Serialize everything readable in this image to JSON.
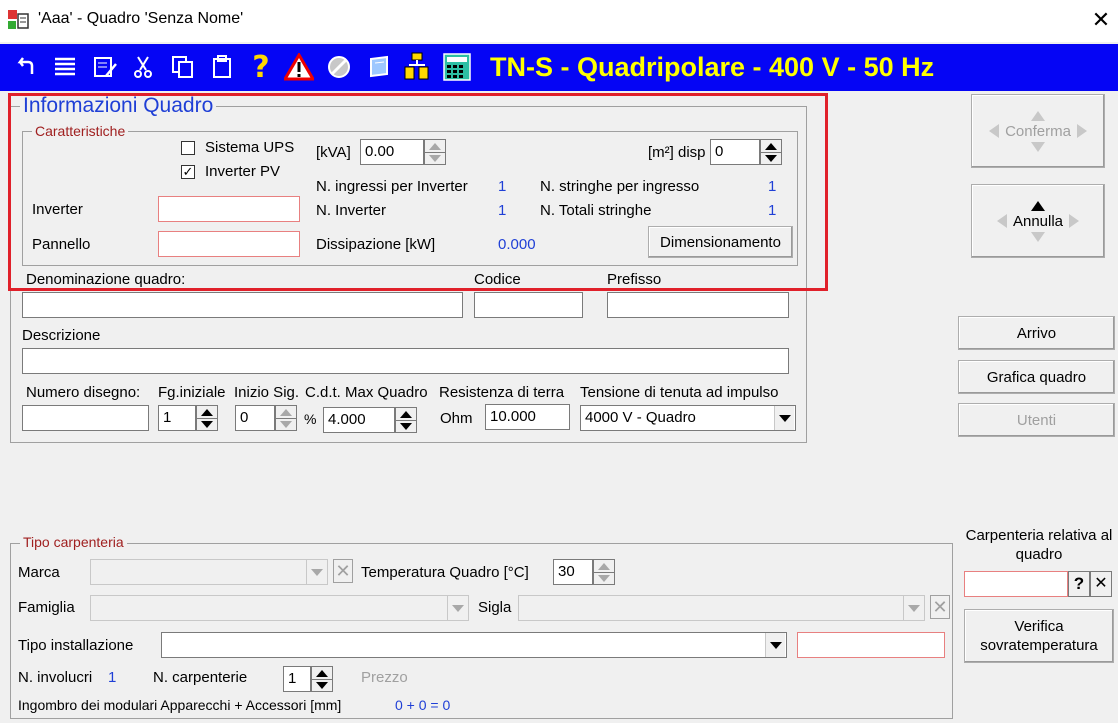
{
  "window": {
    "title": "'Aaa' - Quadro 'Senza Nome'",
    "close_glyph": "✕"
  },
  "toolbar": {
    "title": "TN-S - Quadripolare - 400 V - 50 Hz"
  },
  "info": {
    "legend": "Informazioni Quadro",
    "caratteristiche": {
      "legend": "Caratteristiche",
      "sistema_ups_label": "Sistema UPS",
      "sistema_ups_checked": false,
      "inverter_pv_label": "Inverter PV",
      "inverter_pv_checked": true,
      "check_glyph": "✓",
      "kva_label": "[kVA]",
      "kva_value": "0.00",
      "mq_label": "[m²] disp",
      "mq_value": "0",
      "n_ingressi_label": "N. ingressi per Inverter",
      "n_ingressi_value": "1",
      "n_stringhe_label": "N. stringhe per ingresso",
      "n_stringhe_value": "1",
      "inverter_label": "Inverter",
      "n_inverter_label": "N. Inverter",
      "n_inverter_value": "1",
      "n_totali_label": "N. Totali stringhe",
      "n_totali_value": "1",
      "pannello_label": "Pannello",
      "dissipazione_label": "Dissipazione [kW]",
      "dissipazione_value": "0.000",
      "dimensionamento_label": "Dimensionamento"
    },
    "denominazione_label": "Denominazione quadro:",
    "codice_label": "Codice",
    "prefisso_label": "Prefisso",
    "descrizione_label": "Descrizione",
    "numero_disegno_label": "Numero disegno:",
    "fg_iniziale_label": "Fg.iniziale",
    "fg_iniziale_value": "1",
    "inizio_sig_label": "Inizio Sig.",
    "inizio_sig_value": "0",
    "cdt_label": "C.d.t. Max Quadro",
    "cdt_unit": "%",
    "cdt_value": "4.000",
    "resistenza_label": "Resistenza di terra",
    "resistenza_unit": "Ohm",
    "resistenza_value": "10.000",
    "tensione_label": "Tensione di tenuta ad impulso",
    "tensione_value": "4000 V - Quadro"
  },
  "side": {
    "conferma": "Conferma",
    "annulla": "Annulla",
    "arrivo": "Arrivo",
    "grafica": "Grafica quadro",
    "utenti": "Utenti",
    "carpenteria_relativa": "Carpenteria relativa al quadro",
    "help_glyph": "?",
    "clear_glyph": "✕",
    "verifica": "Verifica sovratemperatura"
  },
  "carpenteria": {
    "legend": "Tipo carpenteria",
    "marca_label": "Marca",
    "temp_label": "Temperatura Quadro [°C]",
    "temp_value": "30",
    "famiglia_label": "Famiglia",
    "sigla_label": "Sigla",
    "tipo_inst_label": "Tipo installazione",
    "n_involucri_label": "N. involucri",
    "n_involucri_value": "1",
    "n_carpenterie_label": "N. carpenterie",
    "n_carpenterie_value": "1",
    "prezzo_label": "Prezzo",
    "ingombro_label": "Ingombro dei modulari Apparecchi + Accessori [mm]",
    "ingombro_value": "0 + 0 = 0",
    "x_glyph": "✕"
  },
  "colors": {
    "toolbar_bg": "#0505f5",
    "toolbar_title": "#ffff00",
    "accent_blue": "#1f3fd6",
    "highlight_red": "#e0202a",
    "legend_red": "#a02020"
  }
}
